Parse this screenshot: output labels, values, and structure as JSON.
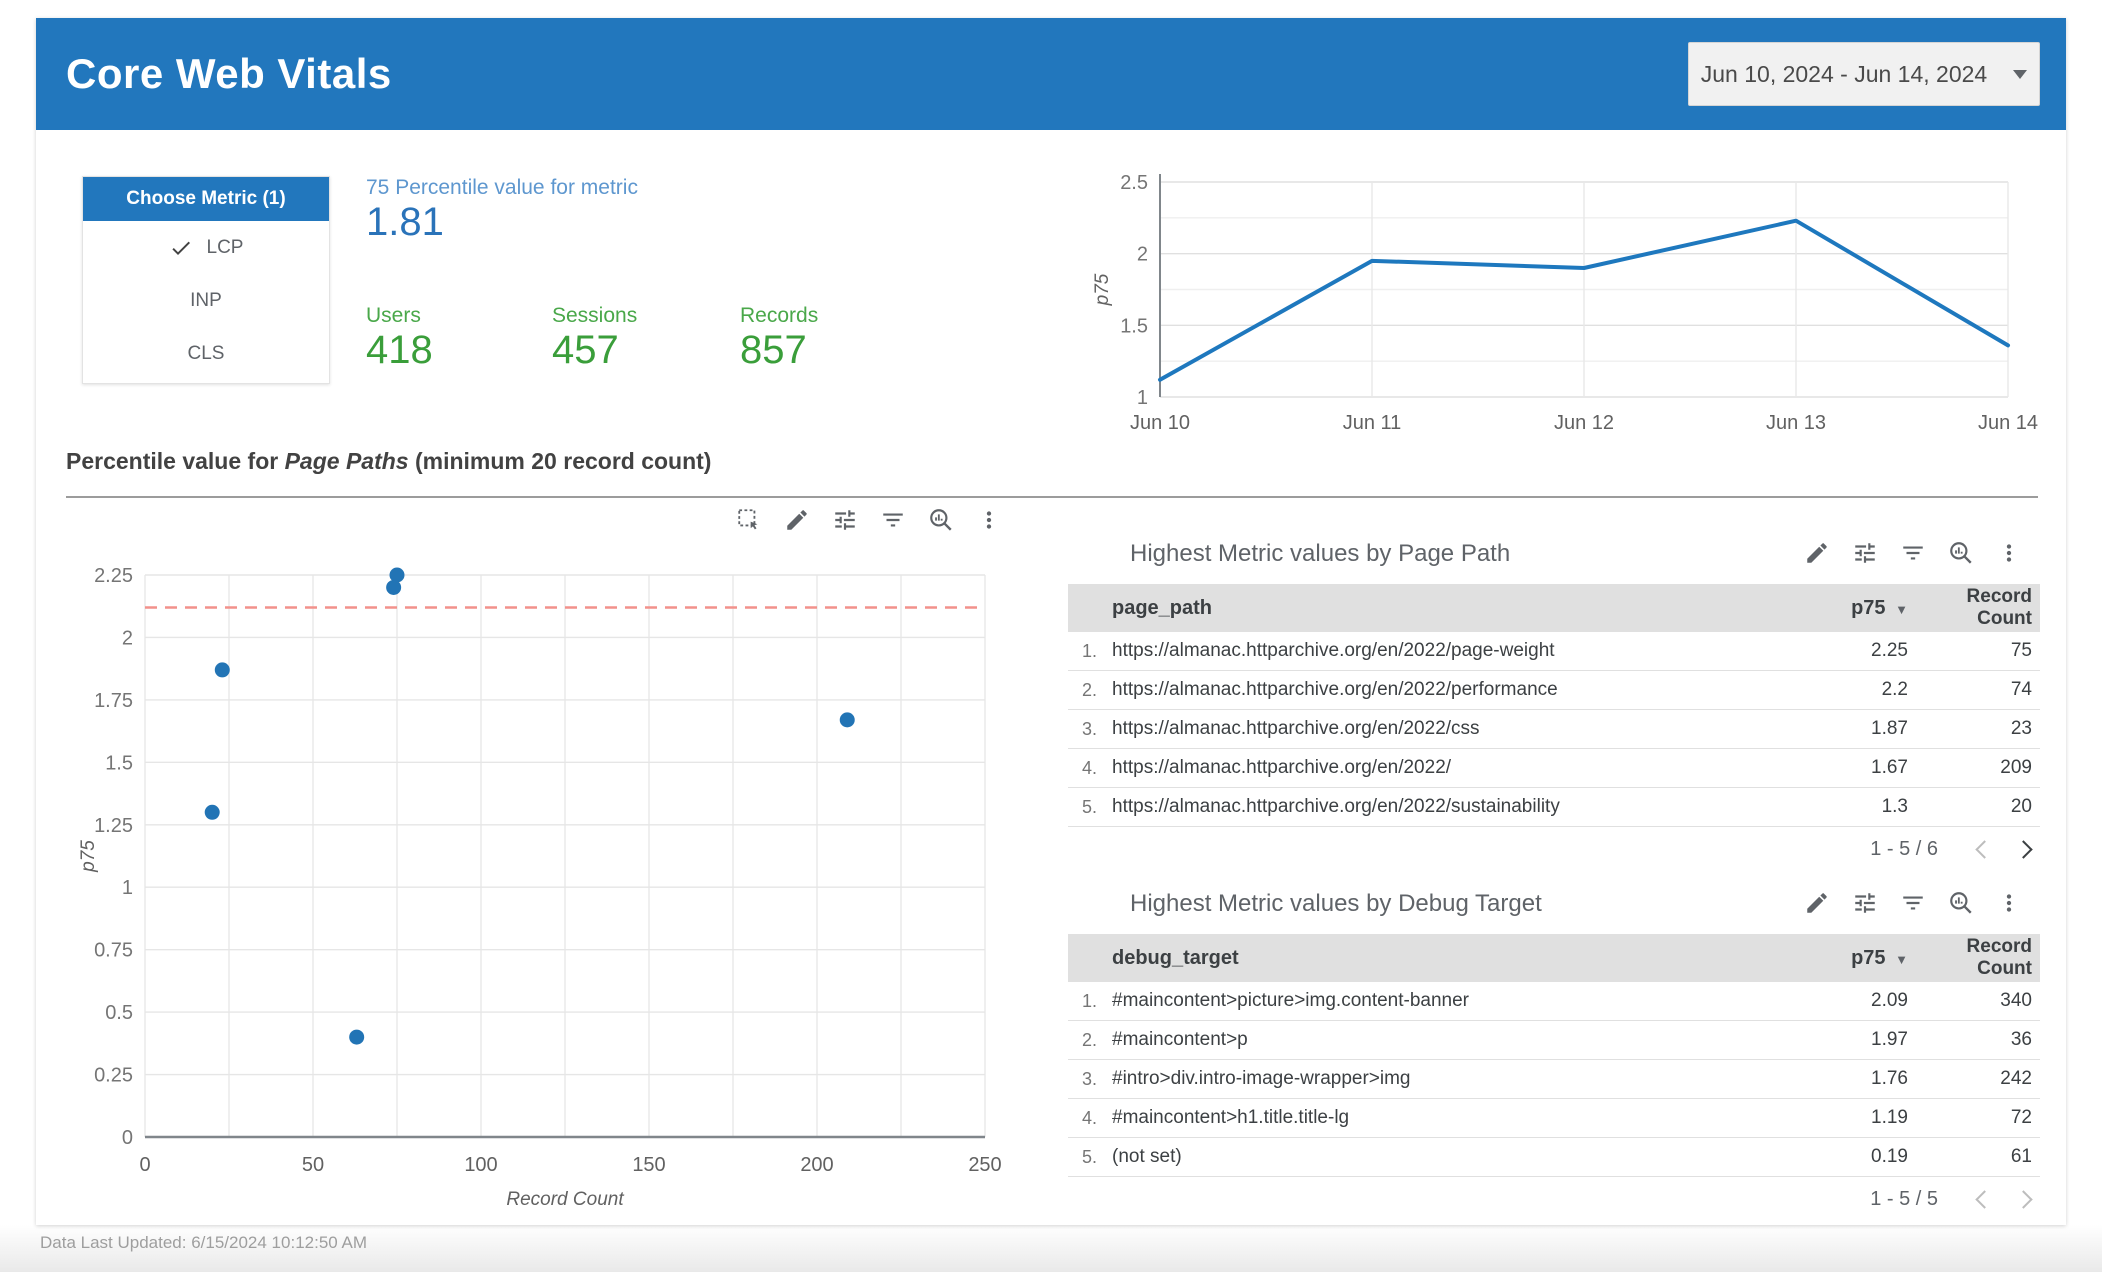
{
  "header": {
    "title": "Core Web Vitals",
    "date_range": "Jun 10, 2024 - Jun 14, 2024"
  },
  "metric_selector": {
    "title": "Choose Metric (1)",
    "options": [
      {
        "label": "LCP",
        "selected": true
      },
      {
        "label": "INP",
        "selected": false
      },
      {
        "label": "CLS",
        "selected": false
      }
    ]
  },
  "scorecards": {
    "percentile": {
      "label": "75 Percentile value for metric",
      "value": "1.81"
    },
    "users": {
      "label": "Users",
      "value": "418"
    },
    "sessions": {
      "label": "Sessions",
      "value": "457"
    },
    "records": {
      "label": "Records",
      "value": "857"
    }
  },
  "section": {
    "title_prefix": "Percentile value for ",
    "title_italic": "Page Paths",
    "title_suffix": " (minimum 20 record count)"
  },
  "scatter_toolbar": [
    "selection",
    "edit",
    "tune",
    "filter",
    "explore",
    "more"
  ],
  "table_toolbar": [
    "edit",
    "tune",
    "filter",
    "explore",
    "more"
  ],
  "chart_data": [
    {
      "type": "line",
      "title": "p75 by date",
      "x": [
        "Jun 10",
        "Jun 11",
        "Jun 12",
        "Jun 13",
        "Jun 14"
      ],
      "values": [
        1.12,
        1.95,
        1.9,
        2.23,
        1.36
      ],
      "xlabel": "",
      "ylabel": "p75",
      "ylim": [
        1,
        2.5
      ],
      "ytick_step": 0.25,
      "ytick_labeled": [
        1,
        1.5,
        2,
        2.5
      ],
      "grid": true,
      "legend": "none"
    },
    {
      "type": "scatter",
      "title": "Percentile value for Page Paths (minimum 20 record count)",
      "points": [
        {
          "x": 75,
          "y": 2.25
        },
        {
          "x": 74,
          "y": 2.2
        },
        {
          "x": 23,
          "y": 1.87
        },
        {
          "x": 209,
          "y": 1.67
        },
        {
          "x": 20,
          "y": 1.3
        },
        {
          "x": 63,
          "y": 0.4
        }
      ],
      "xlabel": "Record Count",
      "ylabel": "p75",
      "xlim": [
        0,
        250
      ],
      "xtick_step": 25,
      "xtick_labeled": [
        0,
        50,
        100,
        150,
        200,
        250
      ],
      "ylim": [
        0,
        2.25
      ],
      "ytick_step": 0.25,
      "reference_line": {
        "y": 2.12,
        "style": "dashed"
      },
      "grid": true,
      "legend": "none"
    }
  ],
  "tables": [
    {
      "title": "Highest Metric values by Page Path",
      "columns": [
        "page_path",
        "p75",
        "Record Count"
      ],
      "sort_column": "p75",
      "rows": [
        {
          "num": "1.",
          "dim": "https://almanac.httparchive.org/en/2022/page-weight",
          "p75": "2.25",
          "count": "75"
        },
        {
          "num": "2.",
          "dim": "https://almanac.httparchive.org/en/2022/performance",
          "p75": "2.2",
          "count": "74"
        },
        {
          "num": "3.",
          "dim": "https://almanac.httparchive.org/en/2022/css",
          "p75": "1.87",
          "count": "23"
        },
        {
          "num": "4.",
          "dim": "https://almanac.httparchive.org/en/2022/",
          "p75": "1.67",
          "count": "209"
        },
        {
          "num": "5.",
          "dim": "https://almanac.httparchive.org/en/2022/sustainability",
          "p75": "1.3",
          "count": "20"
        }
      ],
      "pagination": {
        "range": "1 - 5 / 6",
        "prev_enabled": false,
        "next_enabled": true
      }
    },
    {
      "title": "Highest Metric values by Debug Target",
      "columns": [
        "debug_target",
        "p75",
        "Record Count"
      ],
      "sort_column": "p75",
      "rows": [
        {
          "num": "1.",
          "dim": "#maincontent>picture>img.content-banner",
          "p75": "2.09",
          "count": "340"
        },
        {
          "num": "2.",
          "dim": "#maincontent>p",
          "p75": "1.97",
          "count": "36"
        },
        {
          "num": "3.",
          "dim": "#intro>div.intro-image-wrapper>img",
          "p75": "1.76",
          "count": "242"
        },
        {
          "num": "4.",
          "dim": "#maincontent>h1.title.title-lg",
          "p75": "1.19",
          "count": "72"
        },
        {
          "num": "5.",
          "dim": "(not set)",
          "p75": "0.19",
          "count": "61"
        }
      ],
      "pagination": {
        "range": "1 - 5 / 5",
        "prev_enabled": false,
        "next_enabled": false
      }
    }
  ],
  "footer": {
    "last_updated": "Data Last Updated: 6/15/2024 10:12:50 AM"
  },
  "colors": {
    "accent_blue": "#2277bd",
    "line_stroke": "#1e78be",
    "scatter_point": "#2274b5",
    "reference_line": "#f2918b",
    "score_blue_label": "#5e97cf",
    "score_blue_value": "#2a73b9",
    "score_green_label": "#4aa84a",
    "score_green_value": "#3a9e3a",
    "table_header_bg": "#e0e0e0",
    "icon_gray": "#5f6368"
  }
}
